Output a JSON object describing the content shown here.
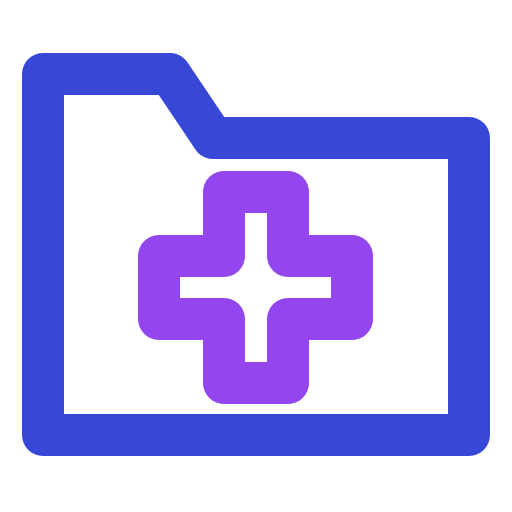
{
  "icon": {
    "name": "medical-folder-icon",
    "parts": [
      {
        "name": "folder-outline-icon",
        "color": "#3748D6"
      },
      {
        "name": "medical-cross-icon",
        "color": "#9446EE"
      }
    ]
  },
  "colors": {
    "background": "#FFFFFF",
    "folder": "#3748D6",
    "cross": "#9446EE"
  }
}
